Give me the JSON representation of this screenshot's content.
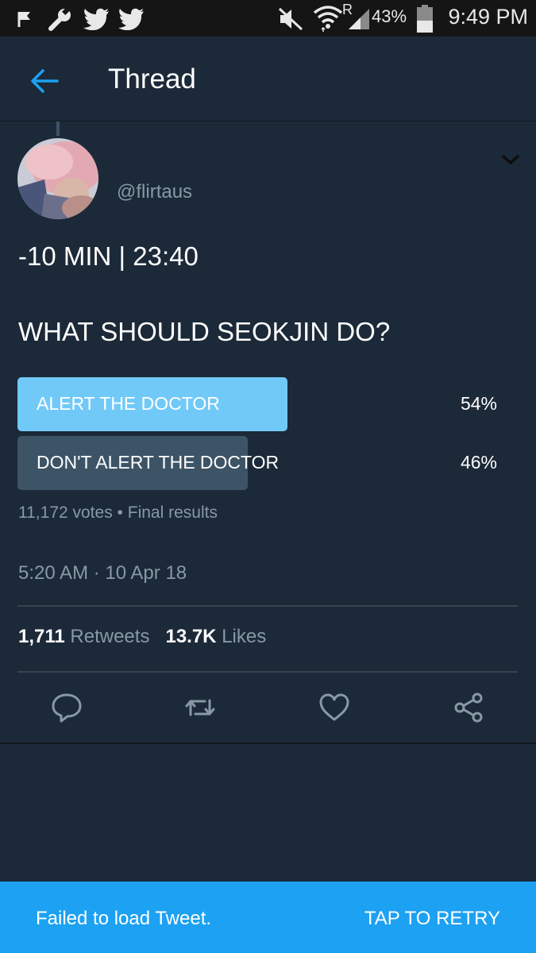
{
  "status_bar": {
    "icons": [
      "flag-icon",
      "wrench-icon",
      "twitter-bird-icon",
      "twitter-bird-icon",
      "mute-icon",
      "wifi-icon",
      "signal-icon",
      "battery-icon"
    ],
    "roaming_label": "R",
    "battery_percent": "43%",
    "time": "9:49 PM"
  },
  "app_bar": {
    "title": "Thread"
  },
  "tweet": {
    "handle": "@flirtaus",
    "text_line1": "-10 MIN | 23:40",
    "text_line2": "WHAT SHOULD SEOKJIN DO?",
    "poll": {
      "options": [
        {
          "label": "ALERT THE DOCTOR",
          "percent_label": "54%",
          "share": 0.54,
          "winner": true,
          "color": "#71c9f8"
        },
        {
          "label": "DON'T ALERT THE DOCTOR",
          "percent_label": "46%",
          "share": 0.46,
          "winner": false,
          "color": "#3d5466"
        }
      ],
      "votes": "11,172 votes",
      "separator": "•",
      "status": "Final results"
    },
    "timestamp": "5:20 AM · 10 Apr 18",
    "stats": {
      "retweets_count": "1,711",
      "retweets_label": "Retweets",
      "likes_count": "13.7K",
      "likes_label": "Likes"
    },
    "actions": [
      "reply-icon",
      "retweet-icon",
      "like-icon",
      "share-icon"
    ]
  },
  "snackbar": {
    "message": "Failed to load Tweet.",
    "action": "TAP TO RETRY"
  },
  "colors": {
    "background": "#1c2938",
    "accent": "#1da1f2",
    "muted_text": "#8899a6",
    "poll_winner": "#71c9f8",
    "poll_other": "#3d5466"
  }
}
